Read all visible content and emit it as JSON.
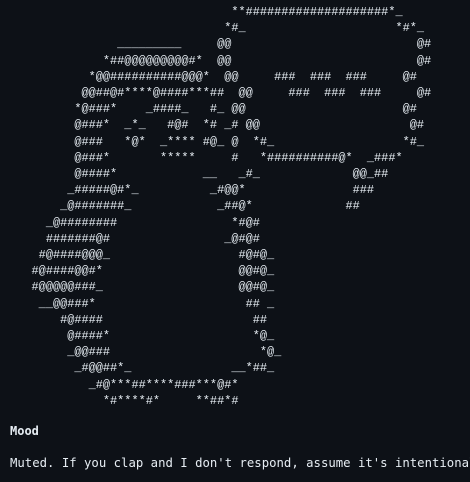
{
  "ascii_art": {
    "lines": [
      "                                **####################*_",
      "                               *#_                     *#*_",
      "                _________     @@                          @#",
      "              *##@@@@@@@@@#*  @@                          @#",
      "            *@@##########@@@*  @@     ###  ###  ###     @#",
      "           @@##@#****@####***##  @@     ###  ###  ###     @#",
      "          *@###*    _####_   #_ @@                      @#",
      "          @###*  _*_   #@#  *# _# @@                     @#",
      "          @###   *@*  _**** #@_ @  *#_                  *#_",
      "          @###*       *****     #   *##########@*  _###*",
      "          @####*            __   _#_             @@_##",
      "         _#####@#*_          _#@@*               ###",
      "        _@#######_            _##@*             ##",
      "      _@########                *#@#",
      "      #######@#                _@#@#",
      "     #@####@@@_                  #@#@_",
      "    #@####@@#*                   @@#@_",
      "    #@@@@@###_                   @@#@_",
      "     __@@###*                     ## _",
      "        #@####                     ##",
      "         @####*                    *@_",
      "         _@@###                     *@_",
      "          _#@@##*_              __*##_",
      "            _#@***##****###***@#*",
      "              *#****#*     **##*#"
    ]
  },
  "mood": {
    "title": "Mood",
    "text": "Muted. If you clap and I don't respond, assume it's intentional."
  }
}
